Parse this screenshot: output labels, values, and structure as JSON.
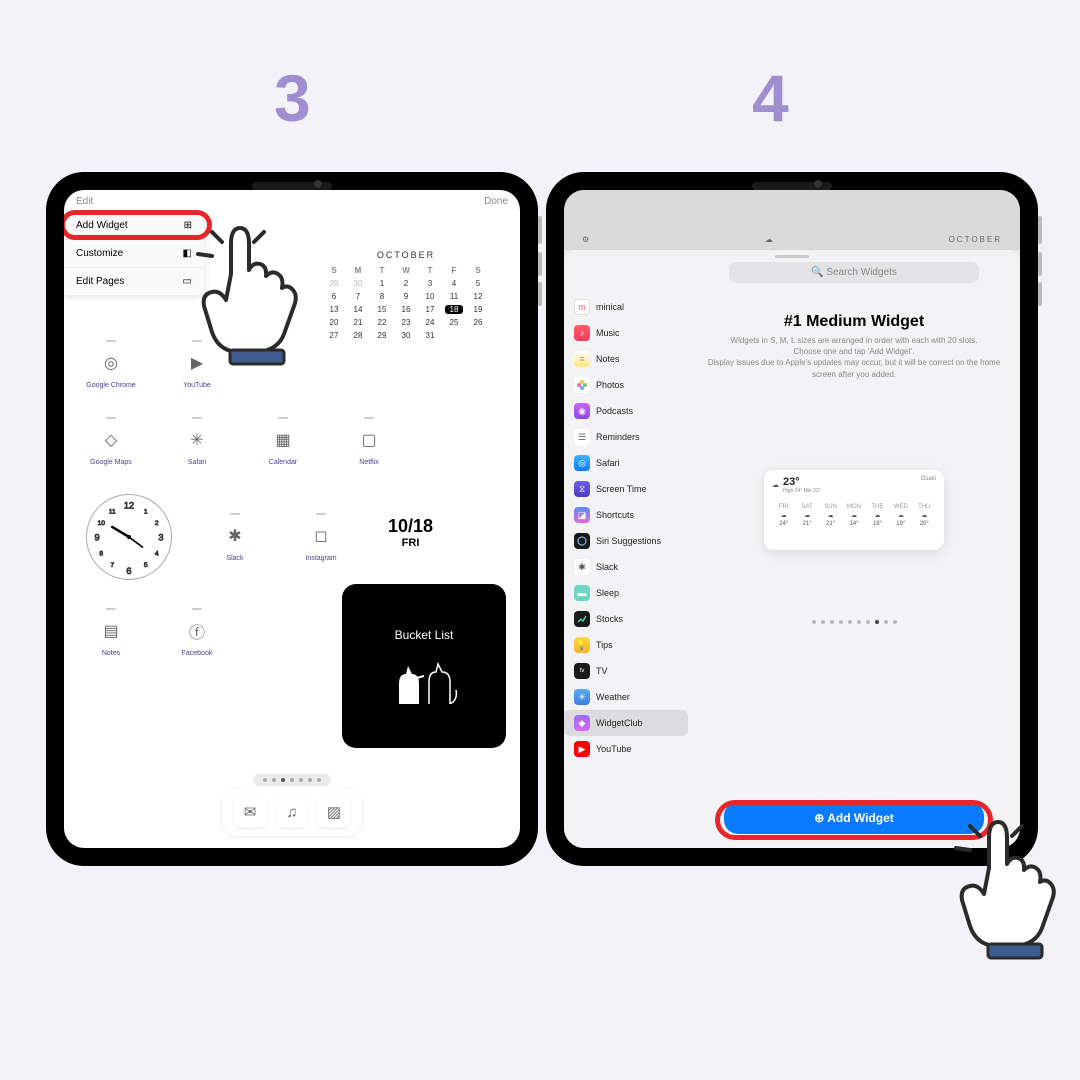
{
  "steps": {
    "s3": "3",
    "s4": "4"
  },
  "screen3": {
    "header": {
      "edit": "Edit",
      "done": "Done"
    },
    "menu": {
      "addWidget": "Add Widget",
      "customize": "Customize",
      "editPages": "Edit Pages"
    },
    "calendar": {
      "month": "OCTOBER",
      "dow": [
        "S",
        "M",
        "T",
        "W",
        "T",
        "F",
        "S"
      ],
      "prev": [
        "29",
        "30"
      ],
      "days": [
        "1",
        "2",
        "3",
        "4",
        "5",
        "6",
        "7",
        "8",
        "9",
        "10",
        "11",
        "12",
        "13",
        "14",
        "15",
        "16",
        "17",
        "18",
        "19",
        "20",
        "21",
        "22",
        "23",
        "24",
        "25",
        "26",
        "27",
        "28",
        "29",
        "30",
        "31"
      ],
      "today": "18"
    },
    "apps": {
      "chrome": "Google Chrome",
      "youtube": "YouTube",
      "maps": "Google Maps",
      "safari": "Safari",
      "calapp": "Calendar",
      "netflix": "Netflix",
      "slack": "Slack",
      "instagram": "Instagram",
      "notes": "Notes",
      "facebook": "Facebook"
    },
    "dateWidget": {
      "date": "10/18",
      "day": "FRI"
    },
    "bucket": "Bucket List"
  },
  "screen4": {
    "topMonth": "OCTOBER",
    "search": "Search Widgets",
    "apps": {
      "minical": "minical",
      "music": "Music",
      "notes": "Notes",
      "photos": "Photos",
      "podcasts": "Podcasts",
      "reminders": "Reminders",
      "safari": "Safari",
      "screentime": "Screen Time",
      "shortcuts": "Shortcuts",
      "siri": "Siri Suggestions",
      "slack": "Slack",
      "sleep": "Sleep",
      "stocks": "Stocks",
      "tips": "Tips",
      "tv": "TV",
      "weather": "Weather",
      "widgetclub": "WidgetClub",
      "youtube": "YouTube"
    },
    "widget": {
      "title": "#1 Medium Widget",
      "desc1": "Widgets in S, M, L sizes are arranged in order with each with 20 slots.",
      "desc2": "Choose one and tap 'Add Widget'.",
      "desc3": "Display issues due to Apple's updates may occur, but it will be correct on the home screen after you added."
    },
    "weather": {
      "temp": "23°",
      "hilo": "High 24° Min 23°",
      "loc": "Osaki",
      "days": [
        "FRI",
        "SAT",
        "SUN",
        "MON",
        "TUE",
        "WED",
        "THU"
      ],
      "temps": [
        "24°",
        "21°",
        "21°",
        "14°",
        "18°",
        "19°",
        "20°"
      ]
    },
    "addButton": "Add Widget"
  }
}
